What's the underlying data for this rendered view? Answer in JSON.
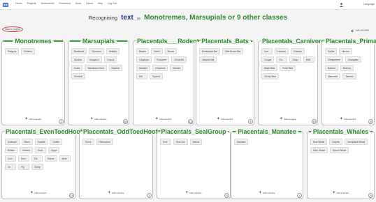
{
  "nav": {
    "items": [
      "Home",
      "Projects",
      "Worksheets",
      "Pretrained",
      "Book",
      "About",
      "Help",
      "Log Out"
    ],
    "language": "Language"
  },
  "header": {
    "prefix": "Recognising",
    "type": "text",
    "as": "as",
    "project_name": "Monotremes, Marsupials or 9 other classes"
  },
  "back_link": "Back to project",
  "add_label": {
    "plus": "+",
    "text": "Add new label"
  },
  "add_example": {
    "plus": "+",
    "text": "Add example"
  },
  "buckets": [
    {
      "name": "Monotremes",
      "count": "2",
      "examples": [
        "Platypus",
        "Echidna"
      ]
    },
    {
      "name": "Marsupials",
      "count": "10",
      "examples": [
        "Bandicoot",
        "Opossum",
        "Wallaby",
        "Quokka",
        "Kangaroo",
        "Cuscus",
        "Koala",
        "Tasmanian Devil",
        "Numbat",
        "Wombat"
      ]
    },
    {
      "name": "Placentals___Rodents",
      "count": "11",
      "examples": [
        "Beaver",
        "Gerbil",
        "Mouse",
        "Capybara",
        "Porcupine",
        "Chinchilla",
        "Hamster",
        "Chipmunk",
        "Marmot",
        "Rat",
        "Squirrel"
      ]
    },
    {
      "name": "Placentals_Bats",
      "count": "3",
      "examples": [
        "Bumblebee Bat",
        "Little Brown Bat",
        "Vampire Bat"
      ]
    },
    {
      "name": "Placentals_Carnivores",
      "count": "10",
      "examples": [
        "Lion",
        "Leopard",
        "Cheetah",
        "Cougar",
        "Fox",
        "Dingo",
        "Wolf",
        "Black Bear",
        "Polar Bear",
        "Grizzly Bear"
      ]
    },
    {
      "name": "Placentals_Primates",
      "count": "6",
      "examples": [
        "Gorilla",
        "Human",
        "Chimpanzee",
        "Orangutan",
        "Baboon",
        "Monkey",
        "Marmoset",
        "Tamarin"
      ]
    },
    {
      "name": "Placentals_EvenToedHoofed",
      "count": "14",
      "examples": [
        "Antelope",
        "Bison",
        "Gazelle",
        "Giraffe",
        "Buffalo",
        "Caribou",
        "Goat",
        "Hippo",
        "Cow",
        "Deer",
        "Elk",
        "Moose",
        "Mule",
        "Ox",
        "Pig",
        "Sheep"
      ]
    },
    {
      "name": "Placentals_OddToedHoofed",
      "count": "2",
      "examples": [
        "Horse",
        "Rhinoceros"
      ]
    },
    {
      "name": "Placentals_SealGroup",
      "count": "3",
      "examples": [
        "Seal",
        "Sea Lion",
        "Walrus"
      ]
    },
    {
      "name": "Placentals_Manatee",
      "count": "1",
      "examples": [
        "Manatee"
      ]
    },
    {
      "name": "Placentals_Whales",
      "count": "5",
      "examples": [
        "Blue Whale",
        "Dolphin",
        "Humpback Whale",
        "Killer Whale",
        "Sperm Whale"
      ]
    }
  ]
}
